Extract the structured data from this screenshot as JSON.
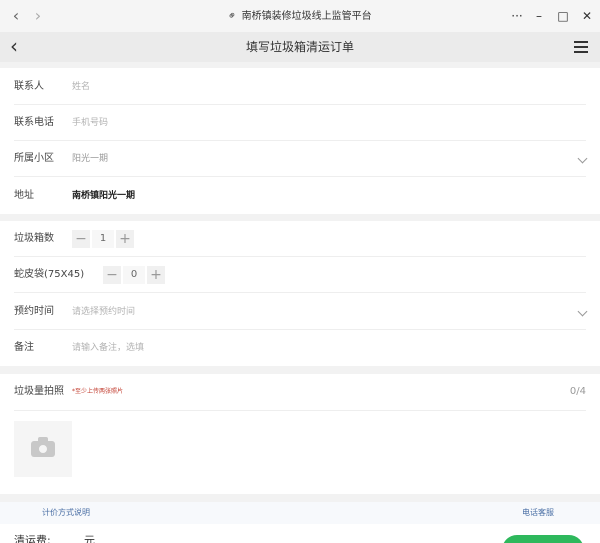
{
  "window": {
    "title": "南桥镇装修垃圾线上监管平台",
    "back_glyph": "‹",
    "forward_glyph": "›",
    "more_glyph": "···",
    "minimize_glyph": "–",
    "maximize_glyph": "□",
    "close_glyph": "✕"
  },
  "nav": {
    "back_glyph": "‹",
    "title": "填写垃圾箱清运订单"
  },
  "form": {
    "contact": {
      "label": "联系人",
      "placeholder": "姓名"
    },
    "phone": {
      "label": "联系电话",
      "placeholder": "手机号码"
    },
    "community": {
      "label": "所属小区",
      "value": "阳光一期"
    },
    "address": {
      "label": "地址",
      "value": "南桥镇阳光一期"
    },
    "bins": {
      "label": "垃圾箱数",
      "minus": "−",
      "plus": "+",
      "value": "1"
    },
    "bags": {
      "label": "蛇皮袋(75X45)",
      "minus": "−",
      "plus": "+",
      "value": "0"
    },
    "appointment": {
      "label": "预约时间",
      "placeholder": "请选择预约时间"
    },
    "remark": {
      "label": "备注",
      "placeholder": "请输入备注，选填"
    }
  },
  "photo": {
    "title": "垃圾量拍照",
    "hint": "*至少上传两张照片",
    "count": "0/4"
  },
  "footer": {
    "pricing_link": "计价方式说明",
    "service_link": "电话客服",
    "fee_label": "清运费:",
    "fee_unit": "元"
  },
  "icons": {
    "link": "link-icon",
    "camera": "camera-icon",
    "menu": "menu-icon",
    "chevron": "chevron-down-icon"
  }
}
